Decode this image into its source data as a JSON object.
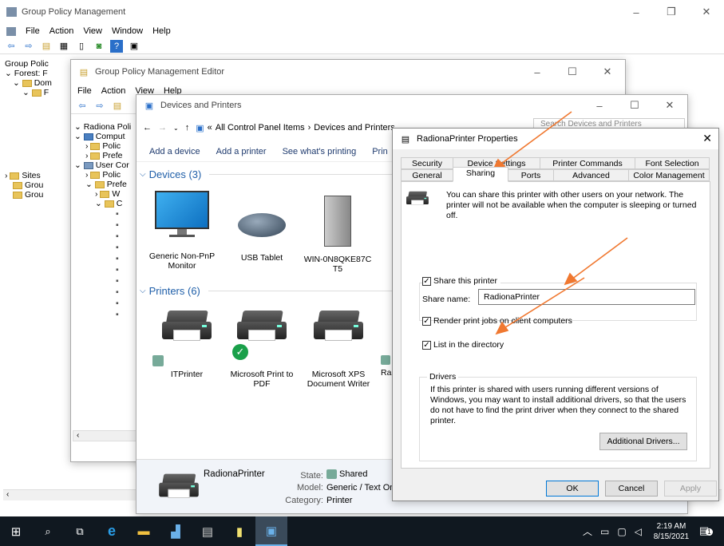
{
  "gpm": {
    "title": "Group Policy Management",
    "menu": [
      "File",
      "Action",
      "View",
      "Window",
      "Help"
    ],
    "tree": [
      "Group Polic",
      "Forest: F",
      "Dom",
      "F",
      "Sites",
      "Grou",
      "Grou"
    ]
  },
  "gpme": {
    "title": "Group Policy Management Editor",
    "menu": [
      "File",
      "Action",
      "View",
      "Help"
    ],
    "tree": [
      "Radiona Poli",
      "Comput",
      "Polic",
      "Prefe",
      "User Cor",
      "Polic",
      "Prefe",
      "W",
      "C"
    ]
  },
  "devices": {
    "title": "Devices and Printers",
    "breadcrumb_prefix": "«",
    "breadcrumb_1": "All Control Panel Items",
    "breadcrumb_sep": "›",
    "breadcrumb_2": "Devices and Printers",
    "search_placeholder": "Search Devices and Printers",
    "cmd": [
      "Add a device",
      "Add a printer",
      "See what's printing",
      "Prin"
    ],
    "devices_header": "Devices (3)",
    "device_items": [
      "Generic Non-PnP Monitor",
      "USB Tablet",
      "WIN-0N8QKE87C T5"
    ],
    "printers_header": "Printers (6)",
    "printer_items": [
      "ITPrinter",
      "Microsoft Print to PDF",
      "Microsoft XPS Document Writer",
      "Ra"
    ],
    "details": {
      "name": "RadionaPrinter",
      "state_label": "State:",
      "state_value": "Shared",
      "model_label": "Model:",
      "model_value": "Generic / Text Only",
      "category_label": "Category:",
      "category_value": "Printer"
    }
  },
  "props": {
    "title": "RadionaPrinter Properties",
    "tabs_row1": [
      "Security",
      "Device Settings",
      "Printer Commands",
      "Font Selection"
    ],
    "tabs_row2": [
      "General",
      "Sharing",
      "Ports",
      "Advanced",
      "Color Management"
    ],
    "info": "You can share this printer with other users on your network. The printer will not be available when the computer is sleeping or turned off.",
    "share_checkbox": "Share this printer",
    "share_name_label": "Share name:",
    "share_name_value": "RadionaPrinter",
    "render_checkbox": "Render print jobs on client computers",
    "list_checkbox": "List in the directory",
    "drivers_group": "Drivers",
    "drivers_text": "If this printer is shared with users running different versions of Windows, you may want to install additional drivers, so that the users do not have to find the print driver when they connect to the shared printer.",
    "additional_drivers": "Additional Drivers...",
    "ok": "OK",
    "cancel": "Cancel",
    "apply": "Apply"
  },
  "taskbar": {
    "time": "2:19 AM",
    "date": "8/15/2021",
    "notification_count": "1"
  },
  "colors": {
    "accent": "#1e5ea8",
    "arrow": "#f07830",
    "taskbar": "#101820"
  }
}
